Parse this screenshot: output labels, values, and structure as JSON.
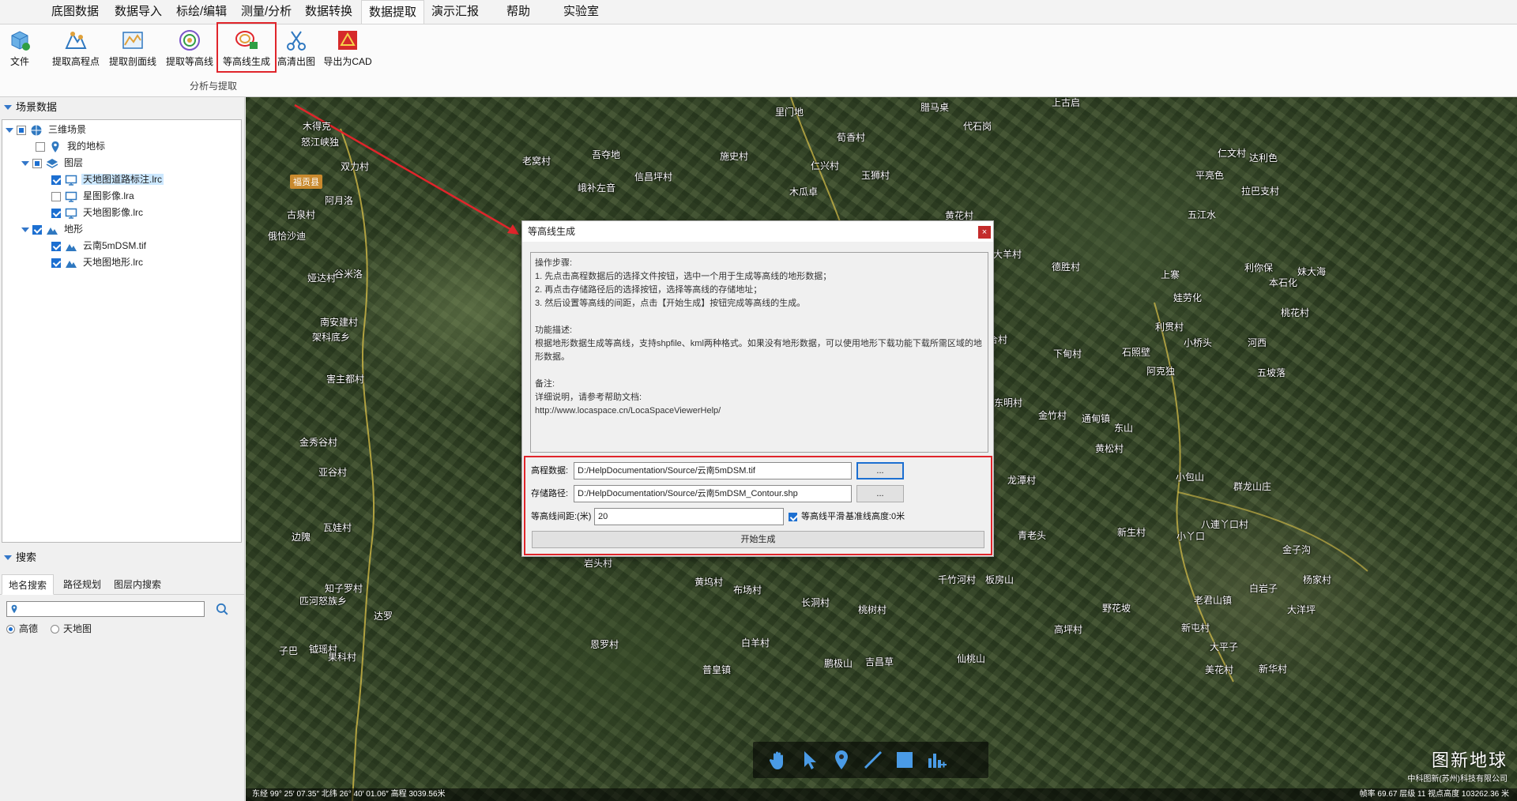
{
  "menu": {
    "tabs": [
      "底图数据",
      "数据导入",
      "标绘/编辑",
      "测量/分析",
      "数据转换",
      "数据提取",
      "演示汇报",
      "帮助",
      "实验室"
    ],
    "active_index": 5
  },
  "ribbon": {
    "file_label": "文件",
    "buttons": [
      "提取高程点",
      "提取剖面线",
      "提取等高线",
      "等高线生成",
      "高清出图",
      "导出为CAD"
    ],
    "group_label": "分析与提取"
  },
  "scene_panel": {
    "title": "场景数据",
    "tree": [
      {
        "label": "三维场景",
        "level": 0,
        "icon": "globe-icon",
        "check": "partial",
        "expand": true
      },
      {
        "label": "我的地标",
        "level": 1,
        "icon": "pin-icon",
        "check": "off",
        "expand": false
      },
      {
        "label": "图层",
        "level": 1,
        "icon": "layers-icon",
        "check": "partial",
        "expand": true
      },
      {
        "label": "天地图道路标注.lrc",
        "level": 2,
        "icon": "monitor-icon",
        "check": "on",
        "selected": true
      },
      {
        "label": "星图影像.lra",
        "level": 2,
        "icon": "monitor-icon",
        "check": "off"
      },
      {
        "label": "天地图影像.lrc",
        "level": 2,
        "icon": "monitor-icon",
        "check": "on"
      },
      {
        "label": "地形",
        "level": 1,
        "icon": "terrain-icon",
        "check": "on",
        "expand": true
      },
      {
        "label": "云南5mDSM.tif",
        "level": 2,
        "icon": "terrain-icon",
        "check": "on"
      },
      {
        "label": "天地图地形.lrc",
        "level": 2,
        "icon": "terrain-icon",
        "check": "on"
      }
    ]
  },
  "search_panel": {
    "title": "搜索",
    "tabs": [
      "地名搜索",
      "路径规划",
      "图层内搜索"
    ],
    "input_value": "",
    "radios": [
      {
        "label": "高德",
        "on": true
      },
      {
        "label": "天地图",
        "on": false
      }
    ]
  },
  "map": {
    "places": [
      {
        "t": "木得克"
      },
      {
        "t": "怒江峡独"
      },
      {
        "t": "双力村"
      },
      {
        "t": "福贡县"
      },
      {
        "t": "阿月洛"
      },
      {
        "t": "古泉村"
      },
      {
        "t": "俄恰沙迪"
      },
      {
        "t": "谷米洛"
      },
      {
        "t": "娅达村"
      },
      {
        "t": "南安建村"
      },
      {
        "t": "架科底乡"
      },
      {
        "t": "害主都村"
      },
      {
        "t": "金秀谷村"
      },
      {
        "t": "亚谷村"
      },
      {
        "t": "瓦娃村"
      },
      {
        "t": "边隗"
      },
      {
        "t": "知子罗村"
      },
      {
        "t": "匹河怒族乡"
      },
      {
        "t": "达罗"
      },
      {
        "t": "子巴"
      },
      {
        "t": "钺瑶村"
      },
      {
        "t": "果科村"
      },
      {
        "t": "老窝村"
      },
      {
        "t": "吾夺地"
      },
      {
        "t": "峨补左音"
      },
      {
        "t": "信昌坪村"
      },
      {
        "t": "施史村"
      },
      {
        "t": "里门地"
      },
      {
        "t": "荀香村"
      },
      {
        "t": "仁兴村"
      },
      {
        "t": "木瓜卓"
      },
      {
        "t": "玉狮村"
      },
      {
        "t": "腊马桌"
      },
      {
        "t": "代石岗"
      },
      {
        "t": "上古启"
      },
      {
        "t": "仁文村"
      },
      {
        "t": "达利色"
      },
      {
        "t": "平亮色"
      },
      {
        "t": "拉巴支村"
      },
      {
        "t": "五江水"
      },
      {
        "t": "黄花村"
      },
      {
        "t": "大羊村"
      },
      {
        "t": "德胜村"
      },
      {
        "t": "上寨"
      },
      {
        "t": "利你保"
      },
      {
        "t": "本石化"
      },
      {
        "t": "妹大海"
      },
      {
        "t": "娃劳化"
      },
      {
        "t": "桃花村"
      },
      {
        "t": "联合村"
      },
      {
        "t": "下甸村"
      },
      {
        "t": "石照壁"
      },
      {
        "t": "利贯村"
      },
      {
        "t": "小桥头"
      },
      {
        "t": "河西"
      },
      {
        "t": "阿克独"
      },
      {
        "t": "五坡落"
      },
      {
        "t": "东明村"
      },
      {
        "t": "金竹村"
      },
      {
        "t": "通甸镇"
      },
      {
        "t": "东山"
      },
      {
        "t": "黄松村"
      },
      {
        "t": "龙潭村"
      },
      {
        "t": "小包山"
      },
      {
        "t": "群龙山庄"
      },
      {
        "t": "黄柏村"
      },
      {
        "t": "怒江傈僳族"
      },
      {
        "t": "自治州"
      },
      {
        "t": "石中坪村"
      },
      {
        "t": "新建村"
      },
      {
        "t": "挂登村"
      },
      {
        "t": "竹坪"
      },
      {
        "t": "青老头"
      },
      {
        "t": "新生村"
      },
      {
        "t": "八連丫口村"
      },
      {
        "t": "小丫口"
      },
      {
        "t": "金子沟"
      },
      {
        "t": "岩头村"
      },
      {
        "t": "黄坞村"
      },
      {
        "t": "布场村"
      },
      {
        "t": "长洞村"
      },
      {
        "t": "千竹河村"
      },
      {
        "t": "板房山"
      },
      {
        "t": "杨家村"
      },
      {
        "t": "白岩子"
      },
      {
        "t": "桃树村"
      },
      {
        "t": "野花坡"
      },
      {
        "t": "老君山镇"
      },
      {
        "t": "高坪村"
      },
      {
        "t": "新屯村"
      },
      {
        "t": "恩罗村"
      },
      {
        "t": "白羊村"
      },
      {
        "t": "吉昌草"
      },
      {
        "t": "仙桃山"
      },
      {
        "t": "大平子"
      },
      {
        "t": "大洋坪"
      },
      {
        "t": "普皇镇"
      },
      {
        "t": "鹏极山"
      },
      {
        "t": "美花村"
      },
      {
        "t": "新华村"
      }
    ],
    "status_left": "东经 99° 25′ 07.35″ 北纬 26° 40′ 01.06″ 高程 3039.56米",
    "status_right": "帧率 69.67   层级 11   视点高度 103262.36 米",
    "brand_title": "图新地球",
    "brand_sub": "中科图新(苏州)科技有限公司"
  },
  "dialog": {
    "title": "等高线生成",
    "close": "×",
    "info_lines": [
      "操作步骤:",
      "1. 先点击高程数据后的选择文件按钮，选中一个用于生成等高线的地形数据；",
      "2. 再点击存储路径后的选择按钮，选择等高线的存储地址；",
      "3. 然后设置等高线的间距，点击【开始生成】按钮完成等高线的生成。",
      "",
      "功能描述:",
      "根据地形数据生成等高线，支持shpfile、kml两种格式。如果没有地形数据，可以使用地形下载功能下载所需区域的地形数据。",
      "",
      "备注:",
      "详细说明，请参考帮助文档:",
      "http://www.locaspace.cn/LocaSpaceViewerHelp/"
    ],
    "elevation_label": "高程数据:",
    "elevation_value": "D:/HelpDocumentation/Source/云南5mDSM.tif",
    "storage_label": "存储路径:",
    "storage_value": "D:/HelpDocumentation/Source/云南5mDSM_Contour.shp",
    "browse_label": "...",
    "interval_label": "等高线间距:(米)",
    "interval_value": "20",
    "smooth_label": "等高线平滑",
    "base_label": "基准线高度:0米",
    "start_label": "开始生成"
  }
}
